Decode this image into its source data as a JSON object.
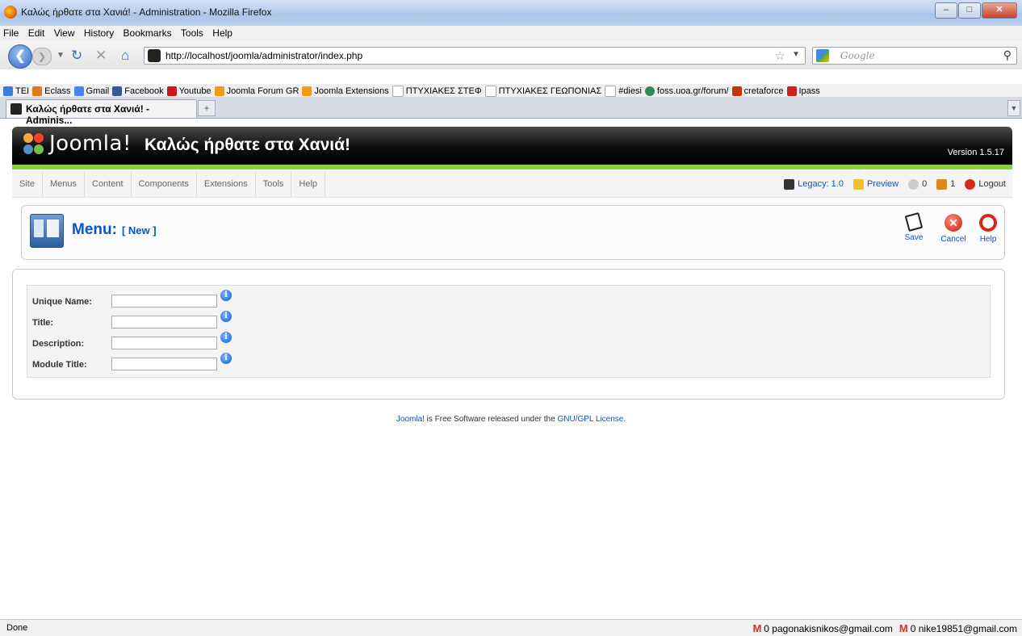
{
  "window": {
    "title": "Καλώς ήρθατε στα Χανιά! - Administration - Mozilla Firefox"
  },
  "menubar": [
    "File",
    "Edit",
    "View",
    "History",
    "Bookmarks",
    "Tools",
    "Help"
  ],
  "navbar": {
    "url": "http://localhost/joomla/administrator/index.php",
    "search_placeholder": "Google"
  },
  "bookmarks": [
    {
      "label": "ΤΕΙ",
      "color": "#3b7dd8"
    },
    {
      "label": "Eclass",
      "color": "#e07b1a"
    },
    {
      "label": "Gmail",
      "color": "#4285f4"
    },
    {
      "label": "Facebook",
      "color": "#3b5998"
    },
    {
      "label": "Youtube",
      "color": "#cc181e"
    },
    {
      "label": "Joomla Forum GR",
      "color": "#f39c12"
    },
    {
      "label": "Joomla Extensions",
      "color": "#f39c12"
    },
    {
      "label": "ΠΤΥΧΙΑΚΕΣ ΣΤΕΦ",
      "color": "#cccccc"
    },
    {
      "label": "ΠΤΥΧΙΑΚΕΣ ΓΕΩΠΟΝΙΑΣ",
      "color": "#cccccc"
    },
    {
      "label": "#diesi",
      "color": "#cccccc"
    },
    {
      "label": "foss.uoa.gr/forum/",
      "color": "#2e8b57"
    },
    {
      "label": "cretaforce",
      "color": "#cc3300"
    },
    {
      "label": "Ipass",
      "color": "#cc2222"
    }
  ],
  "tab": {
    "label": "Καλώς ήρθατε στα Χανιά! - Adminis...",
    "newtab": "+"
  },
  "header": {
    "wordmark": "Joomla!",
    "site_title": "Καλώς ήρθατε στα Χανιά!",
    "version": "Version 1.5.17"
  },
  "admin_menu": [
    "Site",
    "Menus",
    "Content",
    "Components",
    "Extensions",
    "Tools",
    "Help"
  ],
  "status": {
    "legacy": "Legacy: 1.0",
    "preview": "Preview",
    "messages": "0",
    "users": "1",
    "logout": "Logout"
  },
  "toolbar": {
    "title": "Menu:",
    "subtitle": "[ New ]",
    "save": "Save",
    "cancel": "Cancel",
    "help": "Help"
  },
  "form": {
    "fields": [
      {
        "label": "Unique Name:",
        "value": ""
      },
      {
        "label": "Title:",
        "value": ""
      },
      {
        "label": "Description:",
        "value": ""
      },
      {
        "label": "Module Title:",
        "value": ""
      }
    ]
  },
  "footer": {
    "brand": "Joomla!",
    "text": " is Free Software released under the ",
    "license": "GNU/GPL License",
    "end": "."
  },
  "statusbar": {
    "done": "Done",
    "mail1": "0 pagonakisnikos@gmail.com",
    "mail2": "0 nike19851@gmail.com"
  }
}
